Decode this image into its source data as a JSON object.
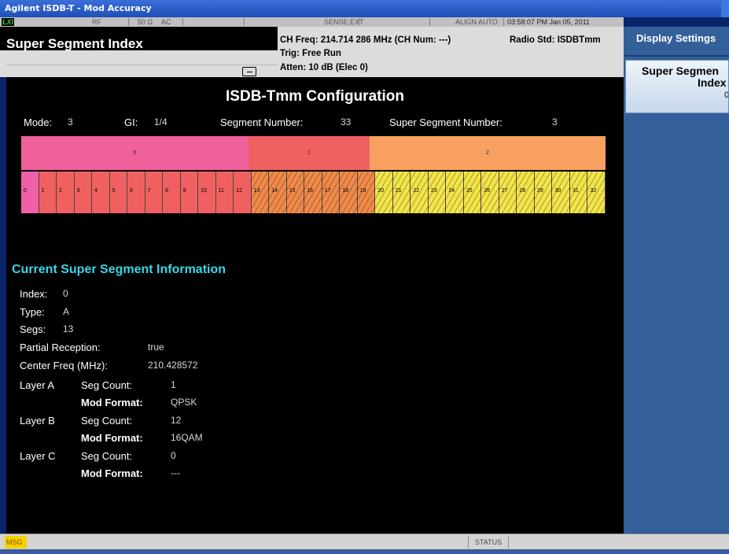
{
  "window": {
    "title": "Agilent ISDB-T - Mod Accuracy"
  },
  "statusbar": {
    "lxi": "LXI",
    "rf": "RF",
    "impedance": "50 Ω",
    "coupling": "AC",
    "sense": "SENSE:EXT",
    "align": "ALIGN AUTO",
    "datetime": "03:58:07 PM Jan 05, 2011"
  },
  "header": {
    "measure_title": "Super Segment Index",
    "ch_freq": "CH Freq: 214.714 286 MHz (CH Num: ---)",
    "radio_std": "Radio Std: ISDBTmm",
    "trig": "Trig: Free Run",
    "atten": "Atten: 10 dB (Elec 0)"
  },
  "config": {
    "title": "ISDB-Tmm Configuration",
    "mode_label": "Mode:",
    "mode_value": "3",
    "gi_label": "GI:",
    "gi_value": "1/4",
    "segnum_label": "Segment Number:",
    "segnum_value": "33",
    "supseg_label": "Super Segment Number:",
    "supseg_value": "3"
  },
  "super_segments": [
    {
      "label": "0",
      "color": "#f0609a"
    },
    {
      "label": "1",
      "color": "#f06060"
    },
    {
      "label": "2",
      "color": "#f8a060"
    }
  ],
  "segments": [
    "0",
    "1",
    "2",
    "3",
    "4",
    "5",
    "6",
    "7",
    "8",
    "9",
    "10",
    "11",
    "12",
    "13",
    "14",
    "15",
    "16",
    "17",
    "18",
    "19",
    "20",
    "21",
    "22",
    "23",
    "24",
    "25",
    "26",
    "27",
    "28",
    "29",
    "30",
    "31",
    "32"
  ],
  "segment_colors": {
    "A": "#f060a8",
    "B": "#f06060"
  },
  "info": {
    "title": "Current Super Segment Information",
    "index_label": "Index:",
    "index_value": "0",
    "type_label": "Type:",
    "type_value": "A",
    "segs_label": "Segs:",
    "segs_value": "13",
    "partial_label": "Partial Reception:",
    "partial_value": "true",
    "center_label": "Center Freq (MHz):",
    "center_value": "210.428572",
    "layers": [
      {
        "name": "Layer A",
        "seg_count_label": "Seg Count:",
        "seg_count": "1",
        "mod_label": "Mod Format:",
        "mod": "QPSK"
      },
      {
        "name": "Layer B",
        "seg_count_label": "Seg Count:",
        "seg_count": "12",
        "mod_label": "Mod Format:",
        "mod": "16QAM"
      },
      {
        "name": "Layer C",
        "seg_count_label": "Seg Count:",
        "seg_count": "0",
        "mod_label": "Mod Format:",
        "mod": "---"
      }
    ]
  },
  "softkeys": {
    "menu_title": "Display Settings",
    "key1_line1": "Super Segmen",
    "key1_line2": "Index",
    "key1_value": "0"
  },
  "bottom": {
    "msg": "MSG",
    "status": "STATUS"
  }
}
